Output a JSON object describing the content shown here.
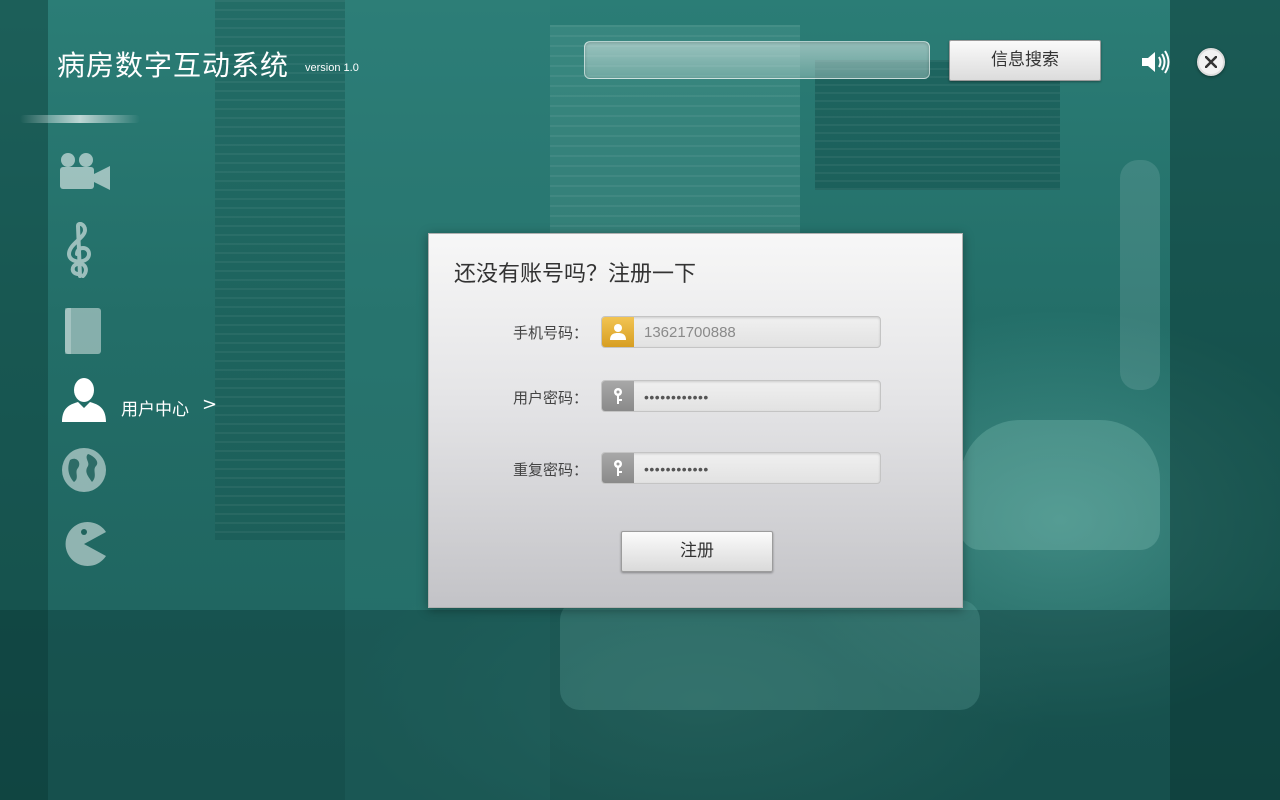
{
  "header": {
    "title": "病房数字互动系统",
    "version": "version 1.0",
    "search_placeholder": "",
    "search_button": "信息搜索",
    "speaker_icon": "speaker-icon",
    "close_icon": "close-icon"
  },
  "sidebar": {
    "items": [
      {
        "icon": "video-camera-icon",
        "label": ""
      },
      {
        "icon": "music-note-icon",
        "label": ""
      },
      {
        "icon": "book-icon",
        "label": ""
      },
      {
        "icon": "user-icon",
        "label": "用户中心",
        "arrow": ">",
        "active": true
      },
      {
        "icon": "globe-icon",
        "label": ""
      },
      {
        "icon": "pacman-game-icon",
        "label": ""
      }
    ]
  },
  "register": {
    "title": "还没有账号吗？注册一下",
    "phone_label": "手机号码：",
    "phone_value": "13621700888",
    "password_label": "用户密码：",
    "password_value": "••••••••••••",
    "confirm_label": "重复密码：",
    "confirm_value": "••••••••••••",
    "submit": "注册"
  },
  "colors": {
    "accent_user_icon": "#e0a933",
    "key_icon": "#999999",
    "background_teal": "#236e68"
  }
}
